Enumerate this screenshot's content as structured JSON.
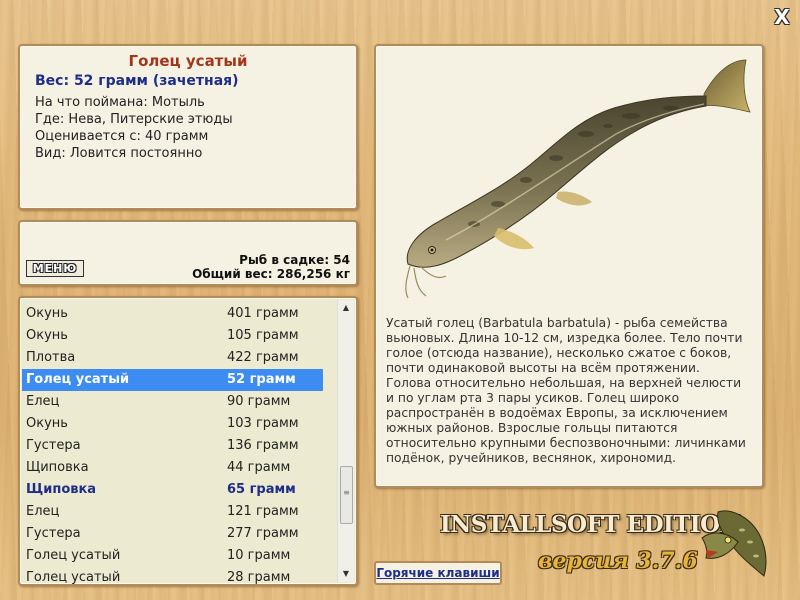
{
  "fish": {
    "name": "Голец усатый",
    "weight": "Вес: 52 грамм (зачетная)",
    "caught_on": "На что поймана: Мотыль",
    "location": "Где: Нева, Питерские этюды",
    "rated_from": "Оценивается с: 40 грамм",
    "kind": "Вид: Ловится постоянно",
    "description": "Усатый голец (Barbatula barbatula) - рыба семейства вьюновых. Длина 10-12 см, изредка более. Тело почти голое (отсюда название), несколько сжатое с боков, почти одинаковой высоты на всём протяжении. Голова относительно небольшая, на верхней челюсти и по углам рта 3 пары усиков. Голец широко распространён в водоёмах Европы, за исключением южных районов. Взрослые гольцы питаются относительно крупными беспозвоночными: личинками подёнок, ручейников, веснянок, хирономид."
  },
  "stats": {
    "count": "Рыб в садке: 54",
    "total_weight": "Общий вес: 286,256 кг"
  },
  "buttons": {
    "menu": "МЕНЮ",
    "hotkeys": "Горячие клавиши",
    "close": "X"
  },
  "catch_list": [
    {
      "name": "Окунь",
      "weight": "401 грамм",
      "state": "normal"
    },
    {
      "name": "Окунь",
      "weight": "105 грамм",
      "state": "normal"
    },
    {
      "name": "Плотва",
      "weight": "422 грамм",
      "state": "normal"
    },
    {
      "name": "Голец усатый",
      "weight": "52 грамм",
      "state": "selected"
    },
    {
      "name": "Елец",
      "weight": "90 грамм",
      "state": "normal"
    },
    {
      "name": "Окунь",
      "weight": "103 грамм",
      "state": "normal"
    },
    {
      "name": "Густера",
      "weight": "136 грамм",
      "state": "normal"
    },
    {
      "name": "Щиповка",
      "weight": "44 грамм",
      "state": "normal"
    },
    {
      "name": "Щиповка",
      "weight": "65 грамм",
      "state": "highlighted"
    },
    {
      "name": "Елец",
      "weight": "121 грамм",
      "state": "normal"
    },
    {
      "name": "Густера",
      "weight": "277 грамм",
      "state": "normal"
    },
    {
      "name": "Голец усатый",
      "weight": "10 грамм",
      "state": "normal"
    },
    {
      "name": "Голец усатый",
      "weight": "28 грамм",
      "state": "normal"
    }
  ],
  "branding": {
    "edition": "INSTALLSOFT EDITION",
    "version": "версия 3.7.6"
  },
  "colors": {
    "selection": "#3d8cf2",
    "title": "#a2361c",
    "accent_blue": "#1f2d8a",
    "panel_bg": "#f6f2e3",
    "wood": "#e2b879"
  },
  "icons": [
    "close-icon",
    "scroll-up-icon",
    "scroll-down-icon",
    "fish-image",
    "pike-logo"
  ]
}
